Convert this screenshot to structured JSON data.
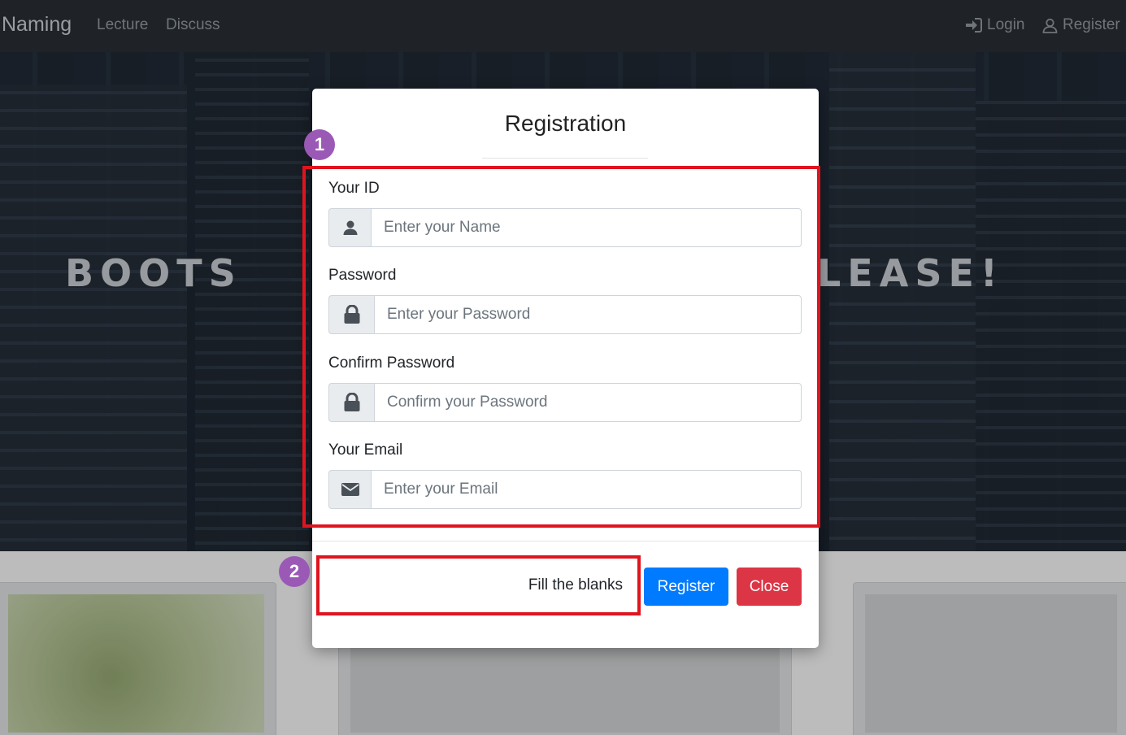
{
  "navbar": {
    "brand": "Naming",
    "links": [
      "Lecture",
      "Discuss"
    ],
    "login_label": "Login",
    "register_label": "Register"
  },
  "hero": {
    "text_left": "BOOTS",
    "text_right": "LEASE!"
  },
  "modal": {
    "title": "Registration",
    "fields": [
      {
        "label": "Your ID",
        "placeholder": "Enter your Name",
        "icon": "user-icon"
      },
      {
        "label": "Password",
        "placeholder": "Enter your Password",
        "icon": "lock-icon"
      },
      {
        "label": "Confirm Password",
        "placeholder": "Confirm your Password",
        "icon": "lock-icon"
      },
      {
        "label": "Your Email",
        "placeholder": "Enter your Email",
        "icon": "envelope-icon"
      }
    ],
    "status_message": "Fill the blanks",
    "register_button": "Register",
    "close_button": "Close"
  },
  "annotations": {
    "badge1": "1",
    "badge2": "2",
    "highlight_color": "#e0141e",
    "badge_color": "#9b59b6"
  },
  "colors": {
    "primary": "#007bff",
    "danger": "#dc3545",
    "navbar": "#1f2327"
  }
}
